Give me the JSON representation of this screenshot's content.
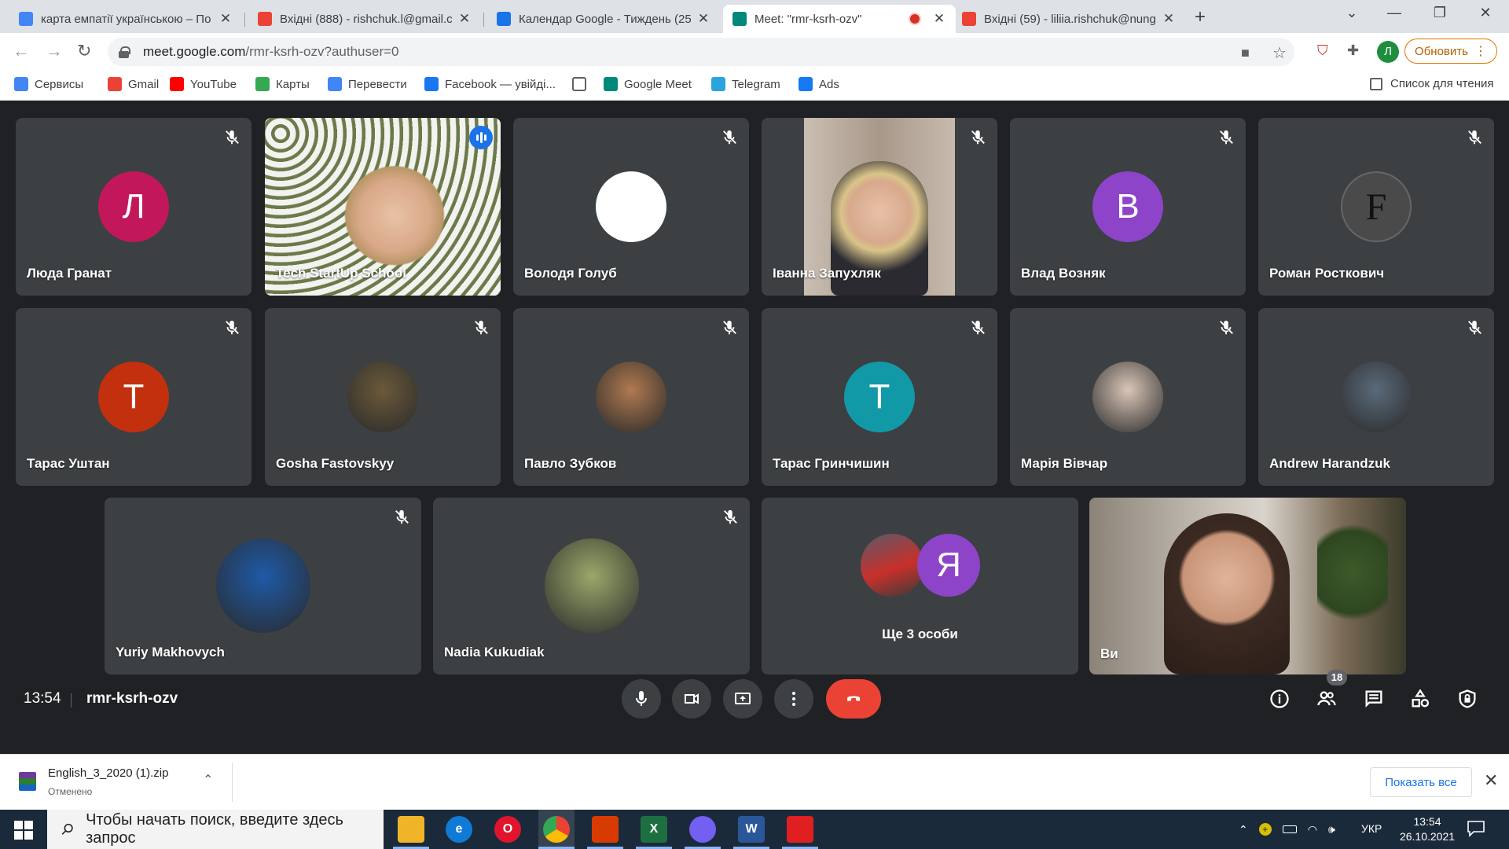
{
  "browser": {
    "tabs": [
      {
        "title": "карта емпатії українською – По",
        "favicon": "google-icon",
        "color": "#4285f4",
        "active": false
      },
      {
        "title": "Вхідні (888) - rishchuk.l@gmail.c",
        "favicon": "gmail-icon",
        "color": "#ea4335",
        "active": false
      },
      {
        "title": "Календар Google - Тиждень (25",
        "favicon": "calendar-icon",
        "color": "#1a73e8",
        "active": false
      },
      {
        "title": "Meet: \"rmr-ksrh-ozv\"",
        "favicon": "meet-icon",
        "color": "#00897b",
        "active": true
      },
      {
        "title": "Вхідні (59) - liliia.rishchuk@nung",
        "favicon": "gmail-icon",
        "color": "#ea4335",
        "active": false
      }
    ],
    "url_main": "meet.google.com",
    "url_rest": "/rmr-ksrh-ozv?authuser=0",
    "profile_initial": "Л",
    "update_label": "Обновить",
    "bookmarks": [
      {
        "label": "Сервисы",
        "icon": "apps-grid-icon",
        "color": "#4285f4"
      },
      {
        "label": "Gmail",
        "icon": "gmail-icon",
        "color": "#ea4335"
      },
      {
        "label": "YouTube",
        "icon": "youtube-icon",
        "color": "#ff0000"
      },
      {
        "label": "Карты",
        "icon": "maps-icon",
        "color": "#34a853"
      },
      {
        "label": "Перевести",
        "icon": "translate-icon",
        "color": "#4285f4"
      },
      {
        "label": "Facebook — увійді...",
        "icon": "facebook-icon",
        "color": "#1877f2"
      },
      {
        "label": "",
        "icon": "page-icon",
        "color": "#5f6368"
      },
      {
        "label": "Google Meet",
        "icon": "meet-icon",
        "color": "#00897b"
      },
      {
        "label": "Telegram",
        "icon": "telegram-icon",
        "color": "#2aa3df"
      },
      {
        "label": "Ads",
        "icon": "facebook-icon",
        "color": "#1877f2"
      }
    ],
    "reading_list": "Список для чтения"
  },
  "meet": {
    "participants": [
      {
        "name": "Люда Гранат",
        "initial": "Л",
        "color": "#c2185b",
        "kind": "letter",
        "muted": true
      },
      {
        "name": "Tech StartUp School",
        "initial": "",
        "color": "#8a7a5c",
        "kind": "video",
        "muted": false,
        "speaking": true
      },
      {
        "name": "Володя Голуб",
        "initial": "",
        "color": "#ffffff",
        "kind": "letter",
        "muted": true
      },
      {
        "name": "Іванна Запухляк",
        "initial": "",
        "color": "#9c8a7a",
        "kind": "video",
        "muted": true
      },
      {
        "name": "Влад Возняк",
        "initial": "В",
        "color": "#8e44c8",
        "kind": "letter",
        "muted": true
      },
      {
        "name": "Роман Росткович",
        "initial": "F",
        "color": "#4a4a4a",
        "kind": "letter",
        "muted": true
      },
      {
        "name": "Тарас Уштан",
        "initial": "Т",
        "color": "#c2300e",
        "kind": "letter",
        "muted": true
      },
      {
        "name": "Gosha Fastovskyy",
        "initial": "",
        "color": "#6b5a3a",
        "kind": "photo",
        "muted": true
      },
      {
        "name": "Павло Зубков",
        "initial": "",
        "color": "#b07a50",
        "kind": "photo",
        "muted": true
      },
      {
        "name": "Тарас Гринчишин",
        "initial": "Т",
        "color": "#1299a8",
        "kind": "letter",
        "muted": true
      },
      {
        "name": "Марія Вівчар",
        "initial": "",
        "color": "#d9c6b8",
        "kind": "photo",
        "muted": true
      },
      {
        "name": "Andrew Harandzuk",
        "initial": "",
        "color": "#5a6a7a",
        "kind": "photo",
        "muted": true
      },
      {
        "name": "Yuriy Makhovych",
        "initial": "",
        "color": "#1e5aa8",
        "kind": "photo",
        "muted": true
      },
      {
        "name": "Nadia Kukudiak",
        "initial": "",
        "color": "#9aa86a",
        "kind": "photo",
        "muted": true
      }
    ],
    "more_label": "Ще 3 особи",
    "more_initial": "Я",
    "self_label": "Ви",
    "time": "13:54",
    "code": "rmr-ksrh-ozv",
    "participant_count": "18"
  },
  "download": {
    "filename": "English_3_2020 (1).zip",
    "status": "Отменено",
    "show_all": "Показать все"
  },
  "taskbar": {
    "search_placeholder": "Чтобы начать поиск, введите здесь запрос",
    "language": "УКР",
    "time": "13:54",
    "date": "26.10.2021",
    "apps": [
      {
        "name": "file-explorer-icon",
        "color": "#f0b429",
        "glyph": ""
      },
      {
        "name": "edge-icon",
        "color": "#0f7bd6",
        "glyph": "e"
      },
      {
        "name": "opera-icon",
        "color": "#e0152d",
        "glyph": "O"
      },
      {
        "name": "chrome-icon",
        "color": "#34a853",
        "glyph": ""
      },
      {
        "name": "office-icon",
        "color": "#d83b01",
        "glyph": ""
      },
      {
        "name": "excel-icon",
        "color": "#1d6f42",
        "glyph": "X"
      },
      {
        "name": "viber-icon",
        "color": "#7360f2",
        "glyph": ""
      },
      {
        "name": "word-icon",
        "color": "#2b579a",
        "glyph": "W"
      },
      {
        "name": "acrobat-icon",
        "color": "#e02020",
        "glyph": ""
      }
    ]
  }
}
